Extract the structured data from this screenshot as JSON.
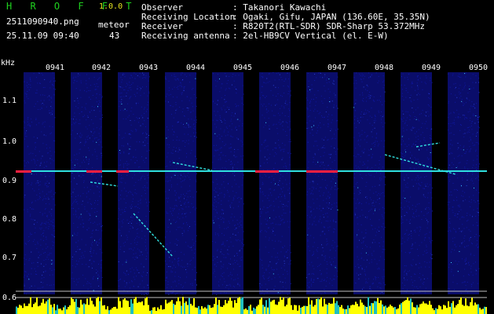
{
  "app": {
    "title": "H R O F F T",
    "version": "1.0.0"
  },
  "image": {
    "filename": "2511090940.png",
    "datetime": "25.11.09 09:40",
    "meteor_label": "meteor",
    "meteor_count": "43"
  },
  "station": [
    {
      "key": "Observer",
      "value": ": Takanori Kawachi"
    },
    {
      "key": "Receiving Location",
      "value": ": Ogaki, Gifu, JAPAN (136.60E, 35.35N)"
    },
    {
      "key": "Receiver",
      "value": ": R820T2(RTL-SDR) SDR-Sharp 53.372MHz"
    },
    {
      "key": "Receiving antenna",
      "value": ": 2el-HB9CV Vertical (el. E-W)"
    }
  ],
  "chart_data": {
    "type": "heatmap",
    "ylabel": "kHz",
    "y_ticks": [
      "1.1",
      "1.0",
      "0.9",
      "0.8",
      "0.7",
      "0.6"
    ],
    "y_tick_values": [
      1.1,
      1.0,
      0.9,
      0.8,
      0.7,
      0.6
    ],
    "x_ticks": [
      "0941",
      "0942",
      "0943",
      "0944",
      "0945",
      "0946",
      "0947",
      "0948",
      "0949",
      "0950"
    ],
    "ylim": [
      0.59,
      1.15
    ],
    "carrier_khz": 0.905,
    "colors": {
      "background": "#000000",
      "noise": "#1018a0",
      "carrier": "#30e0e0",
      "carrier_hot": "#ff2040",
      "bars": "#ffff00",
      "bars_low": "#20c0c0"
    }
  }
}
